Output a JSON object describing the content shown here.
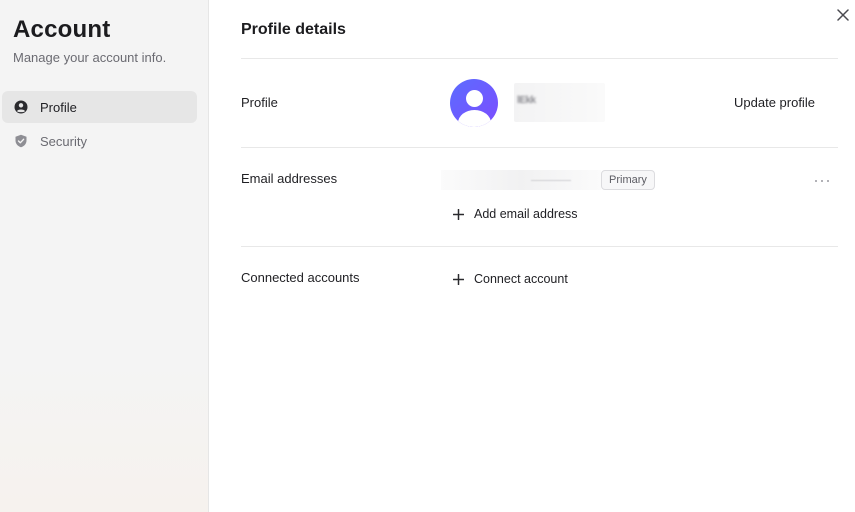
{
  "sidebar": {
    "title": "Account",
    "subtitle": "Manage your account info.",
    "items": [
      {
        "label": "Profile",
        "icon": "user-circle-icon",
        "active": true
      },
      {
        "label": "Security",
        "icon": "shield-icon",
        "active": false
      }
    ]
  },
  "main": {
    "title": "Profile details",
    "profile": {
      "label": "Profile",
      "name": "lEkk",
      "update_label": "Update profile"
    },
    "email": {
      "label": "Email addresses",
      "badge": "Primary",
      "add_label": "Add email address"
    },
    "connected": {
      "label": "Connected accounts",
      "add_label": "Connect account"
    }
  },
  "colors": {
    "accent_gradient_start": "#5b6cff",
    "accent_gradient_end": "#7d4dff"
  }
}
